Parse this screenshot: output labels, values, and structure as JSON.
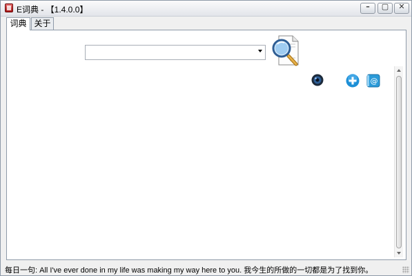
{
  "window": {
    "title": "E词典 - 【1.4.0.0】",
    "buttons": {
      "minimize": "–",
      "maximize": "▢",
      "close": "✕"
    }
  },
  "tabs": [
    {
      "label": "词典",
      "active": true
    },
    {
      "label": "关于",
      "active": false
    }
  ],
  "search": {
    "value": "",
    "placeholder": ""
  },
  "icons": {
    "app": "dictionary-app-icon",
    "search": "magnifier-document-icon",
    "sound": "speaker-icon",
    "add": "add-icon",
    "email": "email-icon"
  },
  "status": {
    "text": "每日一句: All I've ever done in my life was making my way here to you. 我今生的所做的一切都是为了找到你。"
  },
  "colors": {
    "accent": "#1d8fd6",
    "window_border": "#8e9aa8"
  }
}
